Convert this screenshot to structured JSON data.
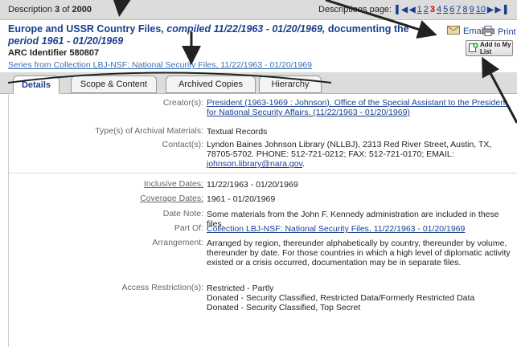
{
  "topbar": {
    "description_prefix": "Description",
    "description_current": "3",
    "description_of": "of",
    "description_total": "2000",
    "pages_label": "Descriptions page:",
    "pages": [
      "1",
      "2",
      "3",
      "4",
      "5",
      "6",
      "7",
      "8",
      "9",
      "10"
    ],
    "current_page": "3"
  },
  "record": {
    "title_main": "Europe and USSR Country Files,",
    "title_italic": "compiled 11/22/1963 - 01/20/1969,",
    "title_bold2": "documenting the",
    "title_line2": "period 1961 - 01/20/1969",
    "arc_label": "ARC Identifier",
    "arc_id": "580807",
    "series_link": "Series from Collection LBJ-NSF: National Security Files, 11/22/1963 - 01/20/1969"
  },
  "actions": {
    "email": "Email",
    "print": "Print",
    "add_to_list": "Add to My List"
  },
  "tabs": [
    "Details",
    "Scope & Content",
    "Archived Copies",
    "Hierarchy"
  ],
  "details": {
    "creator_label": "Creator(s):",
    "creator_value": "President (1963-1969 : Johnson). Office of the Special Assistant to the President for National Security Affairs. (11/22/1963 - 01/20/1969)",
    "types_label": "Type(s) of Archival Materials:",
    "types_value": "Textual Records",
    "contact_label": "Contact(s):",
    "contact_value": "Lyndon Baines Johnson Library (NLLBJ), 2313 Red River Street, Austin, TX, 78705-5702. PHONE: 512-721-0212; FAX: 512-721-0170; EMAIL:",
    "contact_email": "johnson.library@nara.gov",
    "contact_end": ".",
    "inclusive_label": "Inclusive Dates:",
    "inclusive_value": "11/22/1963 - 01/20/1969",
    "coverage_label": "Coverage Dates:",
    "coverage_value": "1961 - 01/20/1969",
    "datenote_label": "Date Note:",
    "datenote_value": "Some materials from the John F. Kennedy administration are included in these files.",
    "partof_label": "Part Of:",
    "partof_value": "Collection LBJ-NSF: National Security Files, 11/22/1963 - 01/20/1969",
    "arrangement_label": "Arrangement:",
    "arrangement_value": "Arranged by region, thereunder alphabetically by country, thereunder by volume, thereunder by date. For those countries in which a high level of diplomatic activity existed or a crisis occurred, documentation may be in separate files.",
    "access_label": "Access Restriction(s):",
    "access_values": [
      "Restricted - Partly",
      "Donated - Security Classified, Restricted Data/Formerly Restricted Data",
      "Donated - Security Classified, Top Secret"
    ]
  },
  "colors": {
    "accent": "#1b3e8f",
    "current_page": "#cc0000",
    "header_bg": "#dcdcdc"
  },
  "icons": [
    "envelope-icon",
    "printer-icon",
    "add-list-icon",
    "first-page-icon",
    "prev-page-icon",
    "next-page-icon",
    "last-page-icon"
  ]
}
